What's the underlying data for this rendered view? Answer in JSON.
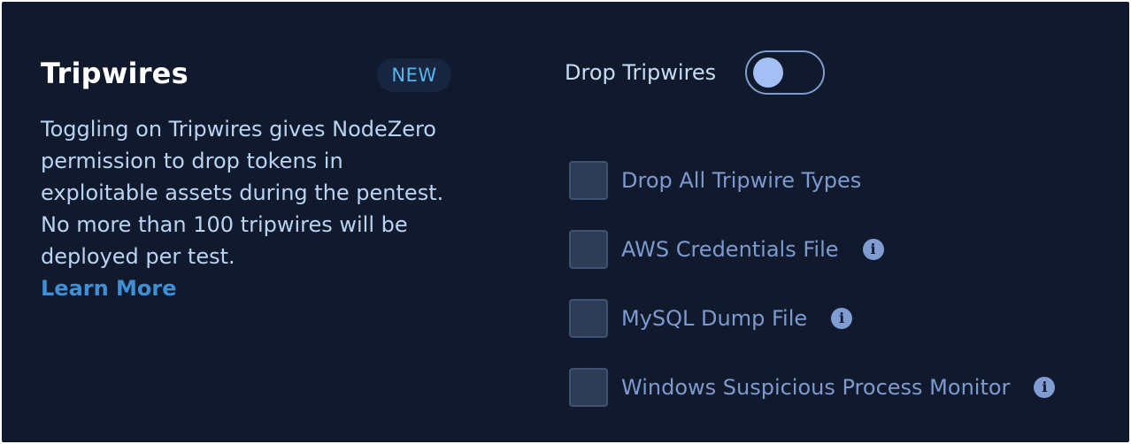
{
  "section": {
    "title": "Tripwires",
    "badge": "NEW",
    "description": "Toggling on Tripwires gives NodeZero permission to drop tokens in exploitable assets during the pentest. No more than 100 tripwires will be deployed per test.",
    "learn_more": "Learn More"
  },
  "toggle": {
    "label": "Drop Tripwires",
    "state": "off"
  },
  "options": [
    {
      "label": "Drop All Tripwire Types",
      "checked": false,
      "info_icon": false
    },
    {
      "label": "AWS Credentials File",
      "checked": false,
      "info_icon": true
    },
    {
      "label": "MySQL Dump File",
      "checked": false,
      "info_icon": true
    },
    {
      "label": "Windows Suspicious Process Monitor",
      "checked": false,
      "info_icon": true
    }
  ],
  "icons": {
    "info": "info-icon",
    "info_glyph": "i"
  },
  "colors": {
    "background": "#111a2c",
    "title": "#ffffff",
    "badge_text": "#56b6ee",
    "badge_bg": "#172541",
    "description": "#b9d4f3",
    "link": "#3f8fd6",
    "option_label": "#7d9ad0",
    "toggle_knob": "#a4bff4"
  }
}
